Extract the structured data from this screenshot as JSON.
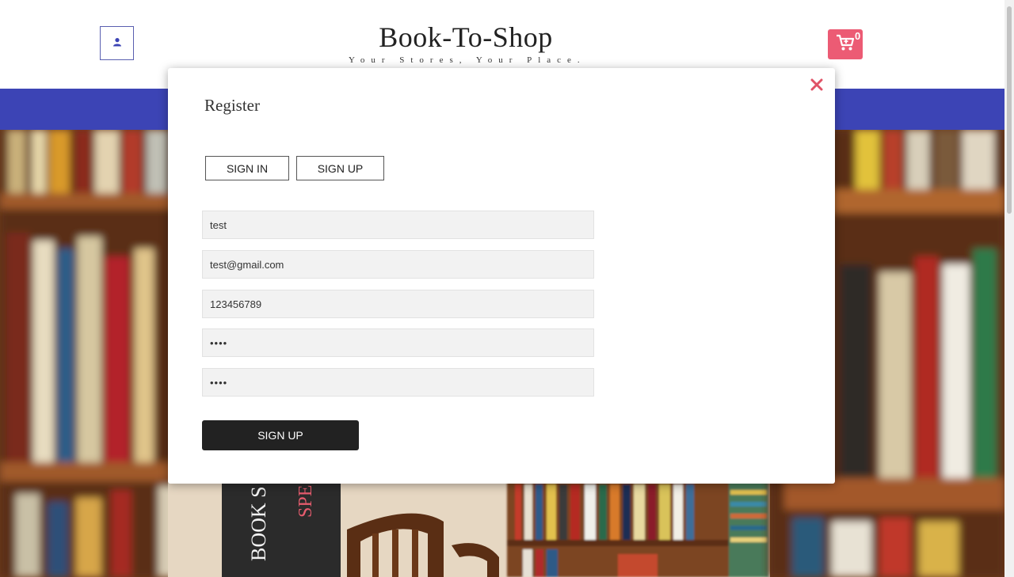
{
  "header": {
    "brand_title": "Book-To-Shop",
    "brand_tagline": "Your Stores, Your Place.",
    "cart_count": "0",
    "user_icon": "user-icon",
    "cart_icon": "cart-icon"
  },
  "hero": {
    "book_spine_text": "BOOK S",
    "book_spine_accent": "SPE"
  },
  "modal": {
    "title": "Register",
    "close_icon": "close-icon",
    "tabs": [
      {
        "label": "SIGN IN"
      },
      {
        "label": "SIGN UP"
      }
    ],
    "fields": [
      {
        "name": "username",
        "value": "test"
      },
      {
        "name": "email",
        "value": "test@gmail.com"
      },
      {
        "name": "phone",
        "value": "123456789"
      },
      {
        "name": "password",
        "value": "test"
      },
      {
        "name": "confirm_password",
        "value": "test"
      }
    ],
    "submit_label": "SIGN UP"
  },
  "colors": {
    "accent": "#ec5b74",
    "nav": "#3c44b5",
    "dark_button": "#222222",
    "field_bg": "#f2f2f2"
  }
}
